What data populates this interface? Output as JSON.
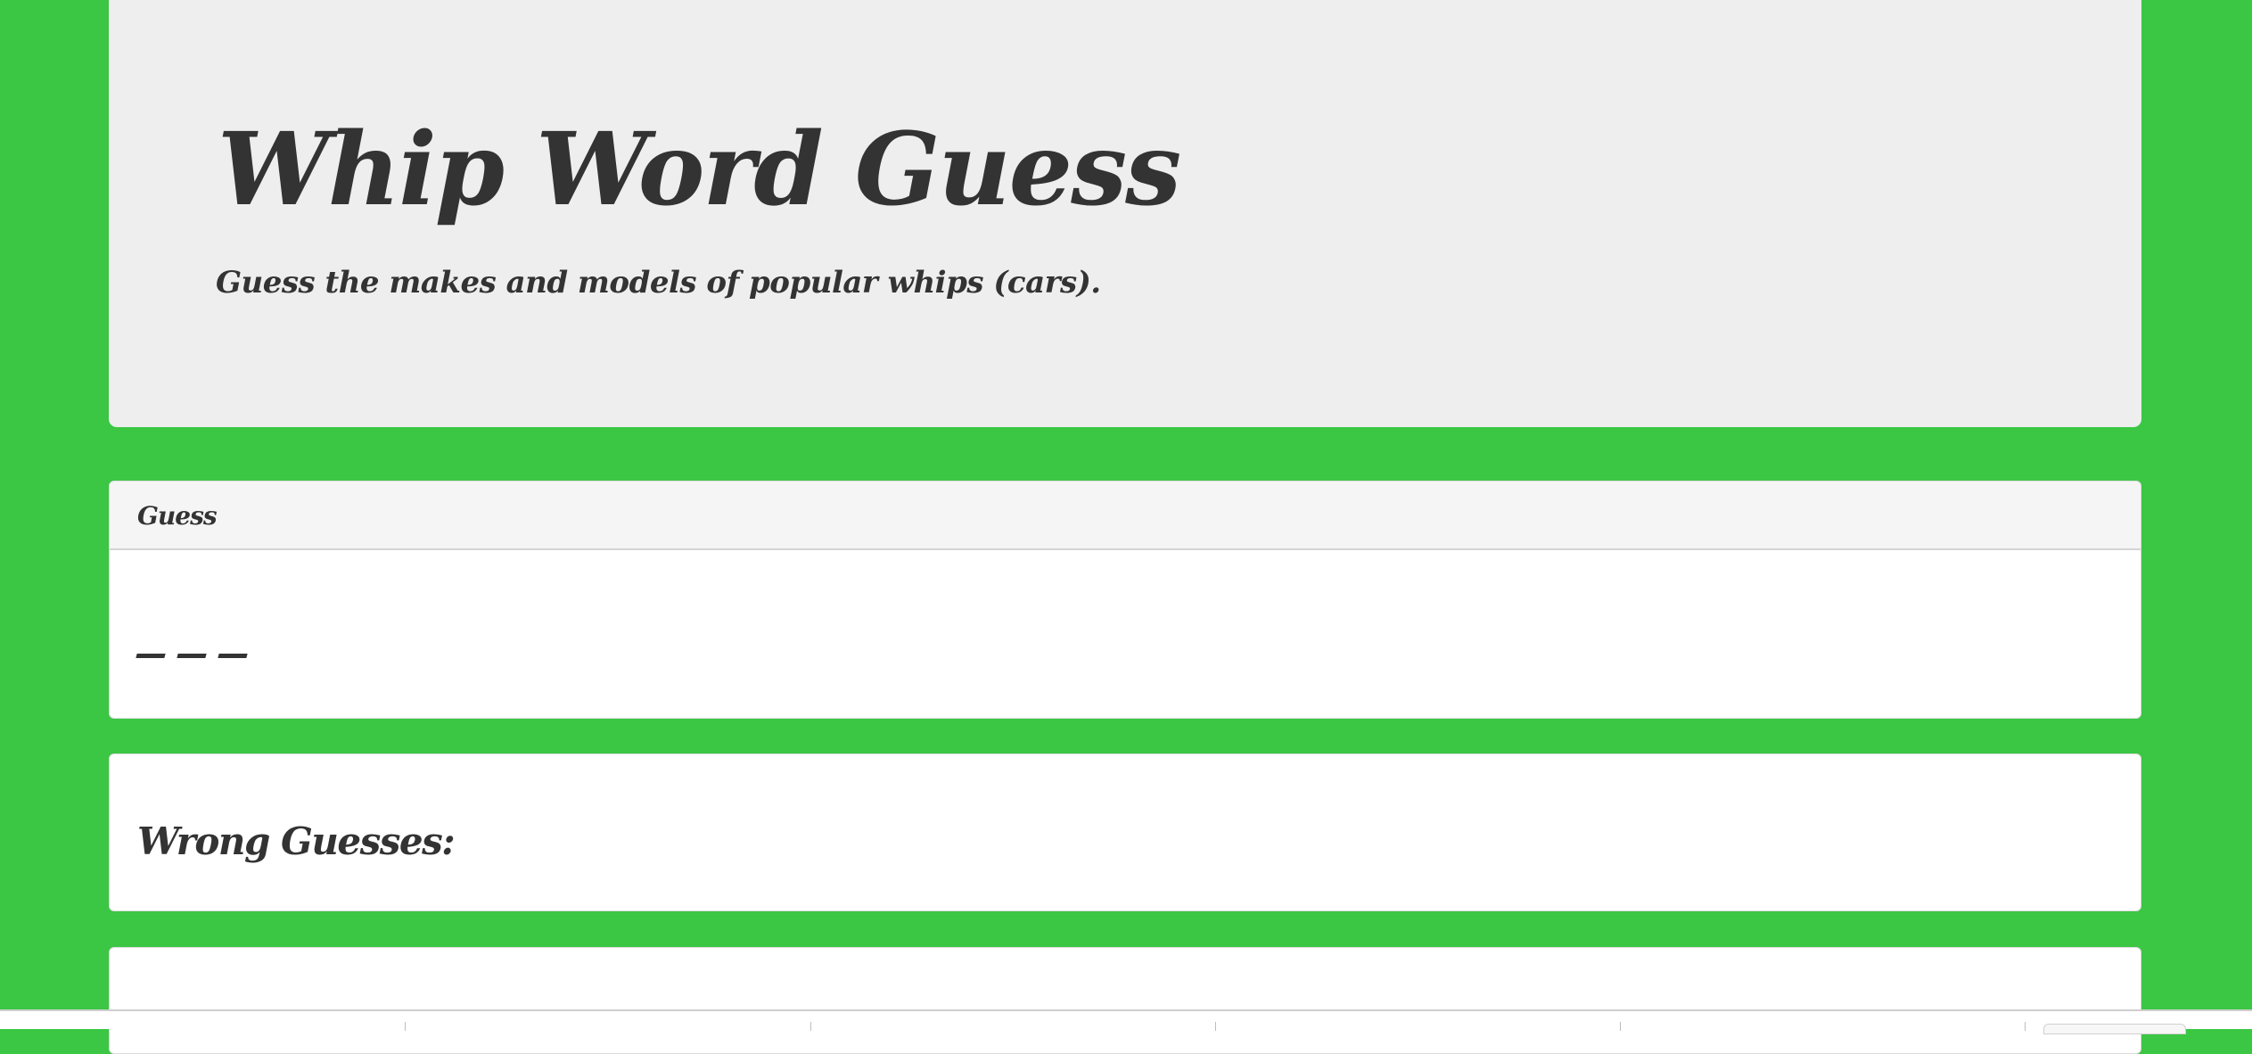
{
  "header": {
    "title": "Whip Word Guess",
    "subtitle": "Guess the makes and models of popular whips (cars)."
  },
  "guess_panel": {
    "heading": "Guess",
    "blank_count": 3
  },
  "wrong_panel": {
    "title": "Wrong Guesses:"
  },
  "colors": {
    "page_background": "#3bc644",
    "jumbotron_background": "#eeeeee",
    "panel_heading_background": "#f5f5f5",
    "text": "#333333"
  }
}
